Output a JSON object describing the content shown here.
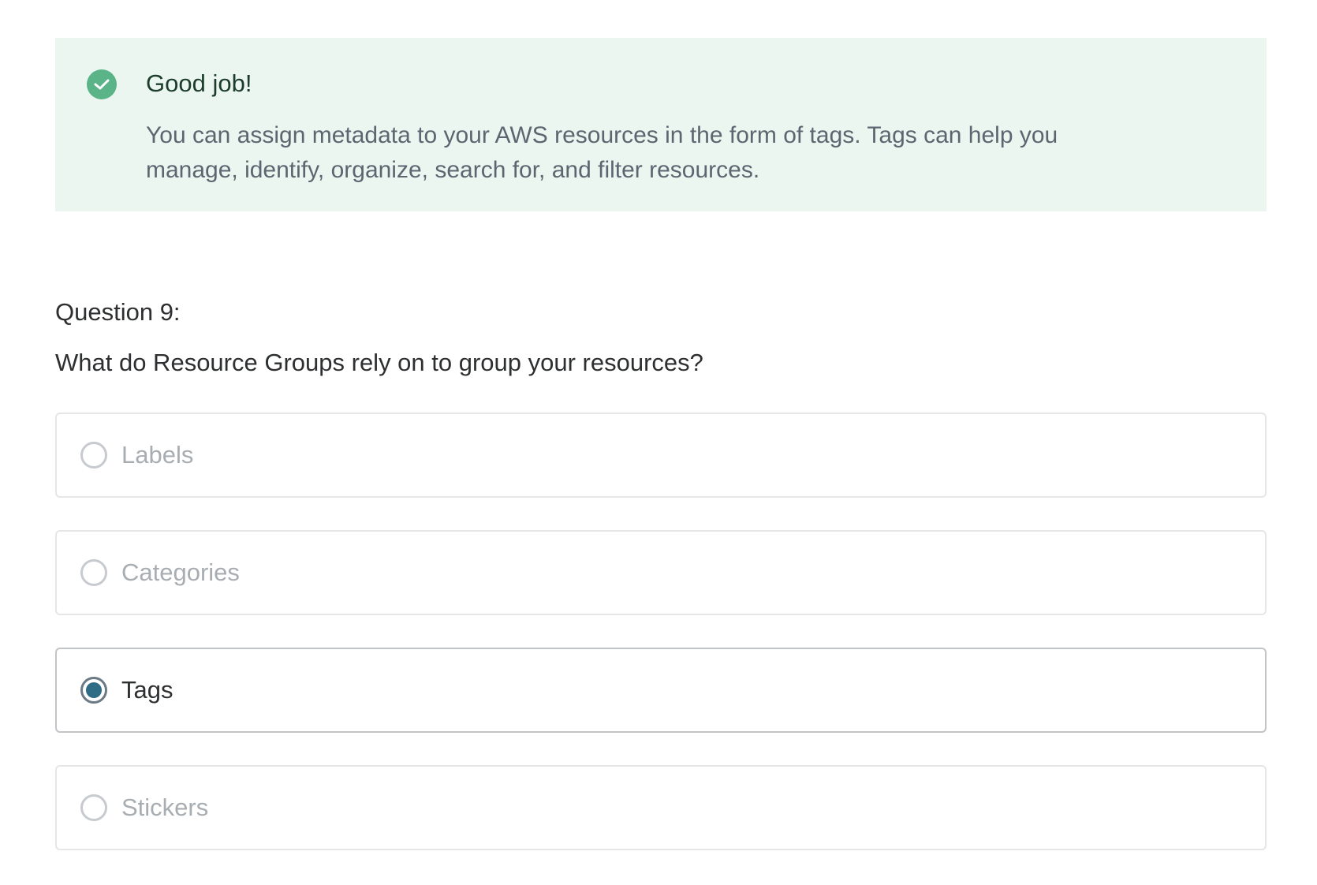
{
  "feedback": {
    "icon": "check-circle-icon",
    "title": "Good job!",
    "body": "You can assign metadata to your AWS resources in the form of tags. Tags can help you manage, identify, organize, search for, and filter resources.",
    "accent_color": "#5bb488",
    "background_color": "#ecf6f0"
  },
  "question": {
    "label": "Question 9:",
    "text": "What do Resource Groups rely on to group your resources?"
  },
  "options": [
    {
      "label": "Labels",
      "selected": false
    },
    {
      "label": "Categories",
      "selected": false
    },
    {
      "label": "Tags",
      "selected": true
    },
    {
      "label": "Stickers",
      "selected": false
    }
  ],
  "colors": {
    "selected_radio": "#2f6c86"
  }
}
